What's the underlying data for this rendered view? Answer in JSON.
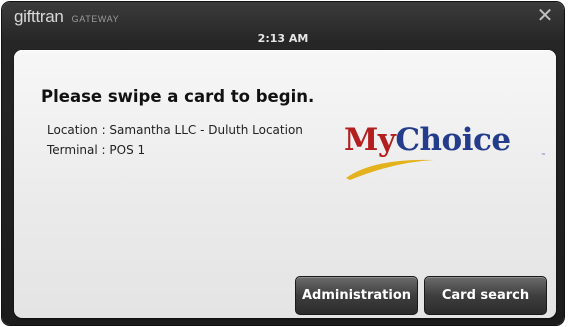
{
  "window": {
    "brand_name": "gifttran",
    "brand_sub": "GATEWAY",
    "time": "2:13 AM",
    "close_glyph": "✕"
  },
  "main": {
    "prompt": "Please swipe a card to begin.",
    "location": "Location : Samantha LLC - Duluth Location",
    "terminal": "Terminal : POS 1"
  },
  "logo": {
    "part1": "My",
    "part2": "Choice",
    "tm": "™"
  },
  "buttons": {
    "administration": "Administration",
    "card_search": "Card search"
  },
  "colors": {
    "logo_red": "#b31e1e",
    "logo_blue": "#243c8c",
    "logo_swoosh": "#e3b21c",
    "chrome_dark": "#1c1c1c",
    "panel_light": "#efefef"
  }
}
